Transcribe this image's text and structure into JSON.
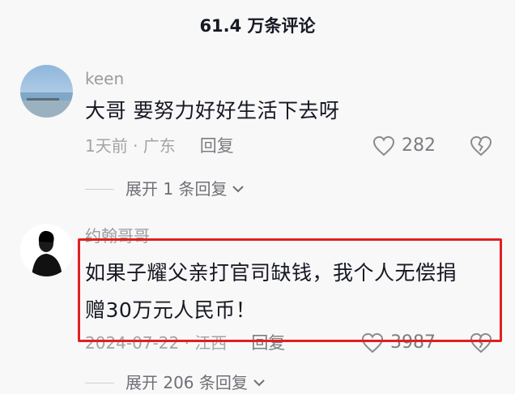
{
  "header": {
    "title": "61.4 万条评论"
  },
  "comments": [
    {
      "username": "keen",
      "text": "大哥 要努力好好生活下去呀",
      "meta": "1天前 · 广东",
      "reply_label": "回复",
      "likes": "282",
      "expand_label": "展开 1 条回复"
    },
    {
      "username": "约翰哥哥",
      "text_line1": "如果子耀父亲打官司缺钱，我个人无偿捐",
      "text_line2": "赠30万元人民币！",
      "meta": "2024-07-22 · 江西",
      "reply_label": "回复",
      "likes": "3987",
      "expand_label": "展开 206 条回复"
    }
  ],
  "colors": {
    "highlight": "#e02020",
    "background": "#f8f8f8"
  }
}
